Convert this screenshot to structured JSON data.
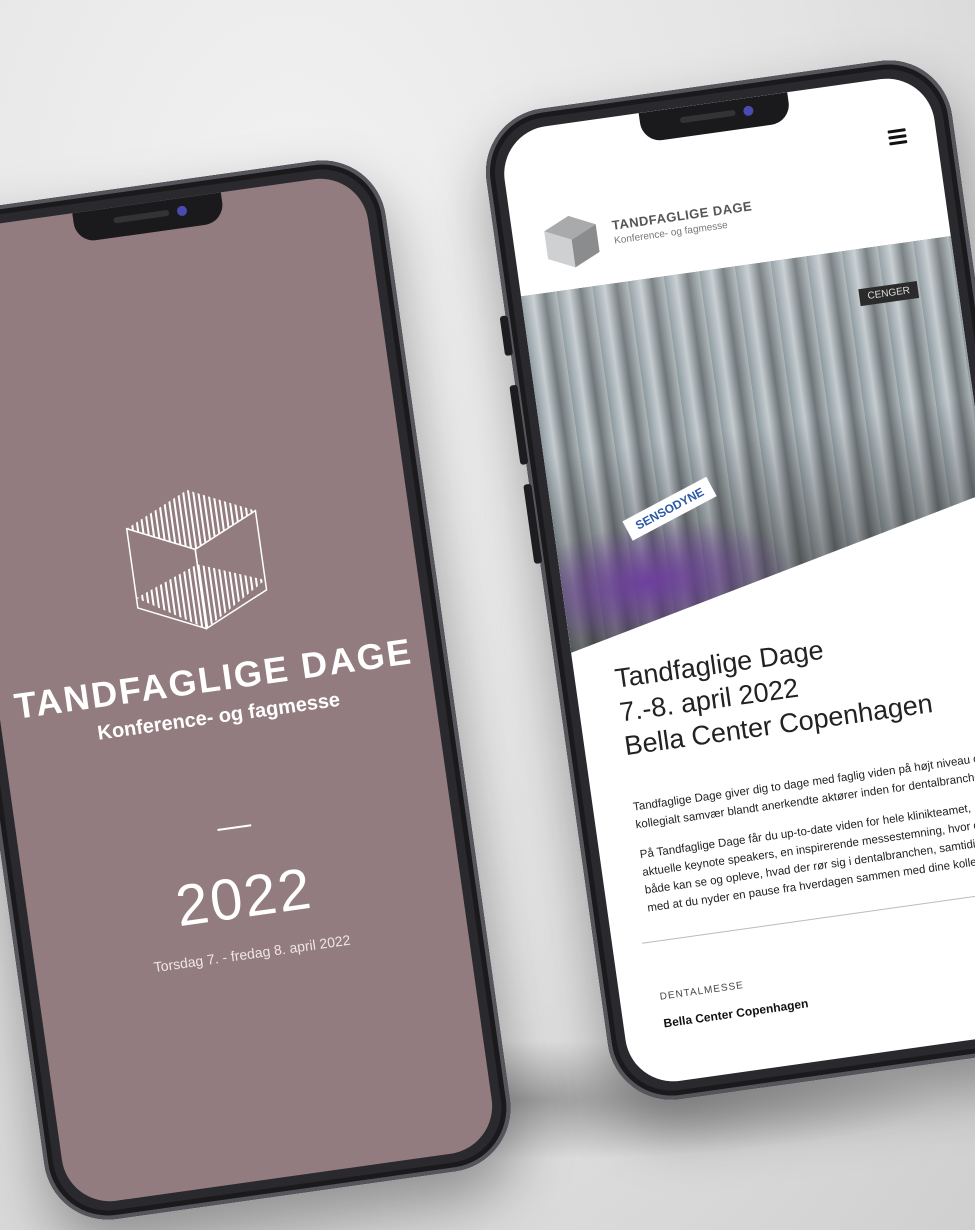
{
  "left_phone": {
    "brand_title": "TANDFAGLIGE DAGE",
    "brand_subtitle": "Konference- og fagmesse",
    "year": "2022",
    "dates": "Torsdag 7. - fredag 8. april 2022",
    "background_color": "#937c80"
  },
  "right_phone": {
    "menu_icon": "hamburger-menu-icon",
    "logo_title": "TANDFAGLIGE DAGE",
    "logo_subtitle": "Konference- og fagmesse",
    "hero_sign_1": "SENSODYNE",
    "hero_sign_2": "CENGER",
    "headline_line1": "Tandfaglige Dage",
    "headline_line2": "7.-8. april 2022",
    "headline_line3": "Bella Center Copenhagen",
    "paragraph1": "Tandfaglige Dage giver dig to dage med faglig viden på højt niveau og kollegialt samvær blandt anerkendte aktører inden for dentalbranchen.",
    "paragraph2": "På Tandfaglige Dage får du up-to-date viden for hele klinikteamet, aktuelle keynote speakers, en inspirerende messestemning, hvor du både kan se og opleve, hvad der rør sig i dentalbranchen, samtidig med at du nyder en pause fra hverdagen sammen med dine kollegaer.",
    "section_label": "DENTALMESSE",
    "section_value": "Bella Center Copenhagen"
  }
}
